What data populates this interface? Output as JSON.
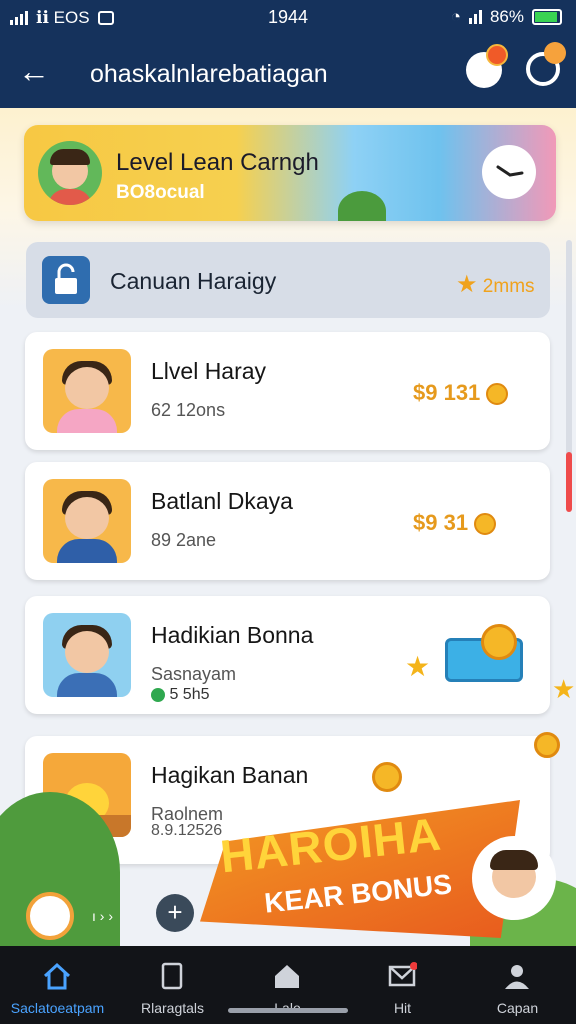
{
  "status": {
    "left": "ℹℹ EOS",
    "time": "1944",
    "battery": "86%"
  },
  "header": {
    "title": "ohaskalnlarebatiagan"
  },
  "banner": {
    "title": "Level Lean Carngh",
    "subtitle": "BO8ocual"
  },
  "summary": {
    "label": "Canuan Haraigy",
    "value": "2mms"
  },
  "items": [
    {
      "title": "Llvel Haray",
      "subtitle": "62 12ons",
      "price": "$9 131"
    },
    {
      "title": "Batlanl Dkaya",
      "subtitle": "89 2ane",
      "price": "$9 31"
    },
    {
      "title": "Hadikian Bonna",
      "subtitle": "Sasnayam",
      "extra": "5 5h5"
    },
    {
      "title": "Hagikan Banan",
      "subtitle": "Raolnem",
      "extra": "8.9.12526"
    }
  ],
  "promo": {
    "line1": "HAROIHA",
    "line2": "KEAR BONUS"
  },
  "bottom_controls": {
    "text": "ı › ›"
  },
  "nav": [
    {
      "label": "Saclatoeatpam",
      "icon": "home-icon",
      "active": true
    },
    {
      "label": "Rlaragtals",
      "icon": "bookmark-icon",
      "active": false
    },
    {
      "label": "Lalo",
      "icon": "house-icon",
      "active": false
    },
    {
      "label": "Hit",
      "icon": "inbox-icon",
      "active": false
    },
    {
      "label": "Capan",
      "icon": "user-icon",
      "active": false
    }
  ],
  "colors": {
    "header": "#15325c",
    "accent": "#f0a21c",
    "nav_active": "#4aa3ff"
  }
}
